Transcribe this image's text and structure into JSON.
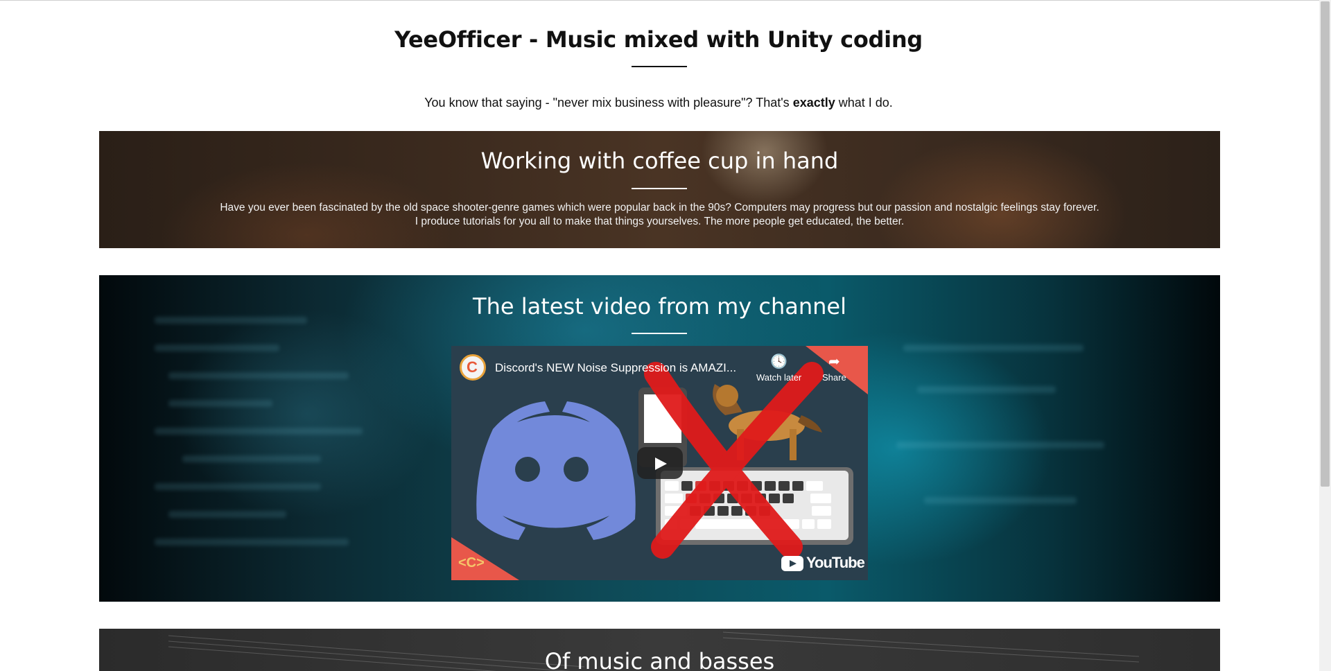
{
  "header": {
    "title": "YeeOfficer - Music mixed with Unity coding",
    "intro_before": "You know that saying - \"never mix business with pleasure\"? That's ",
    "intro_bold": "exactly",
    "intro_after": " what I do."
  },
  "section_coffee": {
    "title": "Working with coffee cup in hand",
    "line1": "Have you ever been fascinated by the old space shooter-genre games which were popular back in the 90s? Computers may progress but our passion and nostalgic feelings stay forever.",
    "line2": "I produce tutorials for you all to make that things yourselves. The more people get educated, the better."
  },
  "section_video": {
    "title": "The latest video from my channel",
    "video": {
      "title": "Discord's NEW Noise Suppression is AMAZI...",
      "watch_later": "Watch later",
      "share": "Share",
      "youtube_label": "YouTube",
      "channel_letter": "C",
      "icons": {
        "watch_later": "clock-icon",
        "share": "share-arrow-icon",
        "play": "play-icon",
        "youtube": "youtube-logo"
      }
    }
  },
  "section_music": {
    "title": "Of music and basses"
  },
  "colors": {
    "accent_red": "#e8574a",
    "text_dark": "#111111"
  }
}
